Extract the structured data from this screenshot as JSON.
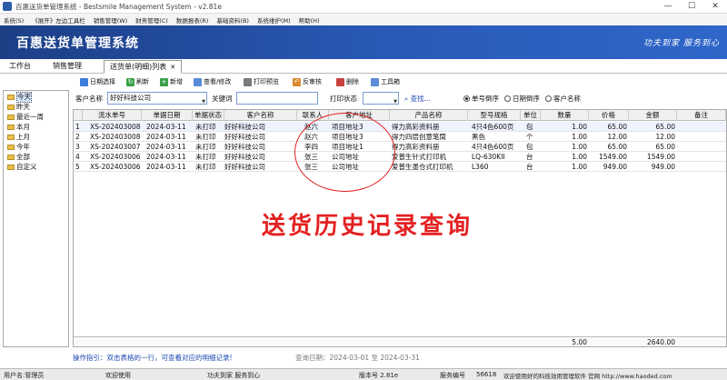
{
  "window": {
    "title": "百惠送货单管理系统 - Bestsmile Management System - v2.81e"
  },
  "menu": [
    "系统(S)",
    "《展开》左边工具栏",
    "销售管理(W)",
    "财务管理(C)",
    "数据报表(R)",
    "基础资料(B)",
    "系统维护(M)",
    "帮助(H)"
  ],
  "banner": {
    "title": "百惠送货单管理系统",
    "slogan": "功夫到家 服务到心"
  },
  "tabs": [
    {
      "label": "工作台"
    },
    {
      "label": "销售管理"
    },
    {
      "label": "送货单(明细)列表",
      "close": "✕"
    }
  ],
  "toolbar": {
    "period": "日期选择",
    "refresh": "刷新",
    "new": "新增",
    "view_edit": "查看/修改",
    "print_preview": "打印预览",
    "reverse": "反审核",
    "delete": "删除",
    "toolbox": "工具箱"
  },
  "left_items": [
    "今天",
    "昨天",
    "最近一周",
    "本月",
    "上月",
    "今年",
    "全部",
    "自定义"
  ],
  "filter": {
    "customer_label": "客户名称",
    "customer_value": "好好科技公司",
    "keyword_label": "关键词",
    "keyword_value": "",
    "print_status_label": "打印状态",
    "print_status_value": "",
    "search": "查找...",
    "sort_options": [
      "单号倒序",
      "日期倒序",
      "客户名称"
    ]
  },
  "columns": [
    "流水单号",
    "单据日期",
    "单据状态",
    "客户名称",
    "联系人",
    "客户地址",
    "产品名称",
    "型号规格",
    "单位",
    "数量",
    "价格",
    "金额",
    "备注"
  ],
  "rows": [
    {
      "n": "1",
      "no": "XS-202403008",
      "date": "2024-03-11",
      "status": "未打印",
      "customer": "好好科技公司",
      "contact": "赵六",
      "address": "项目地址3",
      "product": "得力高彩资料册",
      "spec": "4只4色600页",
      "unit": "包",
      "qty": "1.00",
      "price": "65.00",
      "amount": "65.00",
      "note": ""
    },
    {
      "n": "2",
      "no": "XS-202403008",
      "date": "2024-03-11",
      "status": "未打印",
      "customer": "好好科技公司",
      "contact": "赵六",
      "address": "项目地址3",
      "product": "得力四层创意笔筒",
      "spec": "黑色",
      "unit": "个",
      "qty": "1.00",
      "price": "12.00",
      "amount": "12.00",
      "note": ""
    },
    {
      "n": "3",
      "no": "XS-202403007",
      "date": "2024-03-11",
      "status": "未打印",
      "customer": "好好科技公司",
      "contact": "李四",
      "address": "项目地址1",
      "product": "得力高彩资料册",
      "spec": "4只4色600页",
      "unit": "包",
      "qty": "1.00",
      "price": "65.00",
      "amount": "65.00",
      "note": ""
    },
    {
      "n": "4",
      "no": "XS-202403006",
      "date": "2024-03-11",
      "status": "未打印",
      "customer": "好好科技公司",
      "contact": "张三",
      "address": "公司地址",
      "product": "爱普生针式打印机",
      "spec": "LQ-630KII",
      "unit": "台",
      "qty": "1.00",
      "price": "1549.00",
      "amount": "1549.00",
      "note": ""
    },
    {
      "n": "5",
      "no": "XS-202403006",
      "date": "2024-03-11",
      "status": "未打印",
      "customer": "好好科技公司",
      "contact": "张三",
      "address": "公司地址",
      "product": "爱普生墨仓式打印机",
      "spec": "L360",
      "unit": "台",
      "qty": "1.00",
      "price": "949.00",
      "amount": "949.00",
      "note": ""
    }
  ],
  "totals": {
    "qty": "5.00",
    "amount": "2640.00"
  },
  "hint": "操作指引：双击表格的一行，可查看对应的明细记录!",
  "date_range": "查询日期：2024-03-01 至 2024-03-31",
  "status_bar": {
    "user": "用户名:管理员",
    "welcome": "欢迎使用",
    "slogan": "功夫到家 服务到心",
    "version": "版本号 2.81e",
    "service_label": "服务编号",
    "service_no": "56618",
    "thanks": "欢迎使用好的科技效用管理软件 官网 http://www.haoded.com"
  },
  "overlay_caption": "送货历史记录查询",
  "colors": {
    "banner": "#2a5ab8",
    "annotation": "#e32121",
    "hint": "#1a48b0"
  }
}
